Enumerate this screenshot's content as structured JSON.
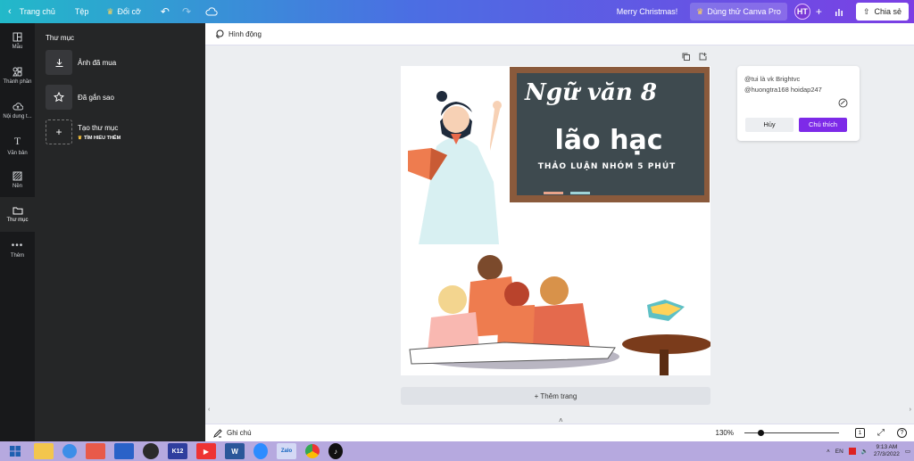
{
  "topbar": {
    "home": "Trang chủ",
    "file": "Tệp",
    "resize": "Đổi cỡ",
    "greeting": "Merry Christmas!",
    "pro": "Dùng thử Canva Pro",
    "avatar": "HT",
    "share": "Chia sẻ"
  },
  "rail": [
    {
      "label": "Mẫu",
      "icon": "template-icon"
    },
    {
      "label": "Thành phần",
      "icon": "elements-icon"
    },
    {
      "label": "Nội dung t...",
      "icon": "upload-icon"
    },
    {
      "label": "Văn bản",
      "icon": "text-icon"
    },
    {
      "label": "Nền",
      "icon": "background-icon"
    },
    {
      "label": "Thư mục",
      "icon": "folder-icon"
    },
    {
      "label": "Thêm",
      "icon": "more-icon"
    }
  ],
  "panel": {
    "title": "Thư mục",
    "purchased": "Ảnh đã mua",
    "starred": "Đã gắn sao",
    "create": "Tạo thư mục",
    "learn_more": "TÌM HIỂU THÊM"
  },
  "toolbar": {
    "animate": "Hình động"
  },
  "design": {
    "line1": "Ngữ văn 8",
    "line2": "lão hạc",
    "line3": "THẢO LUẬN NHÓM 5 PHÚT"
  },
  "add_page": "+ Thêm trang",
  "comment": {
    "line1": "@tui là vk Brightvc",
    "line2": "@huongtra168   hoidap247",
    "cancel": "Hủy",
    "submit": "Chú thích"
  },
  "bottombar": {
    "notes": "Ghi chú",
    "zoom": "130%",
    "zoom_value": 0.17,
    "page_num": "1"
  },
  "taskbar": {
    "lang": "EN",
    "time": "9:13 AM",
    "date": "27/3/2022"
  },
  "colors": {
    "accent": "#7d2ae8",
    "board": "#3e4a4f",
    "board_frame": "#8a5a3c"
  }
}
